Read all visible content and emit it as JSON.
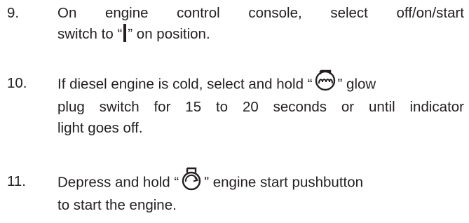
{
  "steps": [
    {
      "number": "9.",
      "line1": "On engine control console, select off/on/start",
      "line2_pre": "switch to “",
      "line2_post": "” on position.",
      "icon": "on-position-bar-icon"
    },
    {
      "number": "10.",
      "line1_pre": "If diesel engine is cold, select and hold “",
      "line1_post": "” glow",
      "line2": "plug switch for 15 to 20 seconds or until indicator",
      "line3": "light goes off.",
      "icon": "glow-plug-icon"
    },
    {
      "number": "11.",
      "line1_pre": "Depress and hold “",
      "line1_post": "” engine start pushbutton",
      "line2": "to start the engine.",
      "icon": "engine-start-icon"
    }
  ],
  "colors": {
    "text": "#231f20"
  }
}
